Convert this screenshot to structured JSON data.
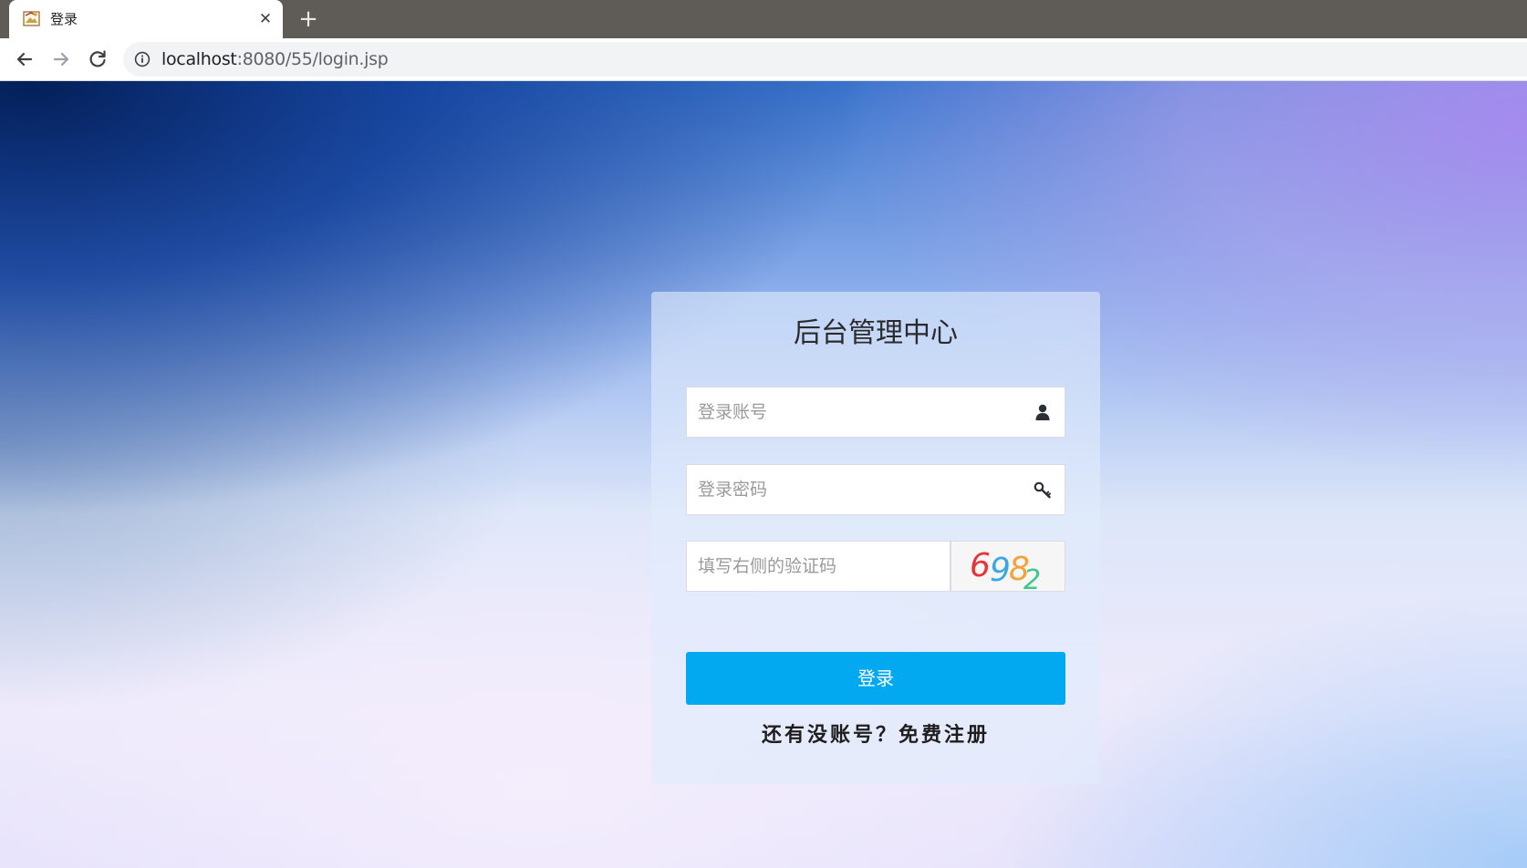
{
  "browser": {
    "tab": {
      "title": "登录",
      "close_glyph": "✕",
      "favicon_icon": "page-favicon-icon"
    },
    "new_tab_glyph": "+",
    "toolbar": {
      "back_icon": "arrow-left-icon",
      "forward_icon": "arrow-right-icon",
      "reload_icon": "reload-icon",
      "info_icon": "info-circle-icon"
    },
    "address": {
      "host": "localhost",
      "rest": ":8080/55/login.jsp"
    }
  },
  "login": {
    "title": "后台管理中心",
    "username_placeholder": "登录账号",
    "username_icon": "user-icon",
    "password_placeholder": "登录密码",
    "password_icon": "key-icon",
    "captcha_placeholder": "填写右侧的验证码",
    "captcha_text": "6982",
    "submit_label": "登录",
    "register_text": "还有没账号？免费注册"
  },
  "colors": {
    "tabstrip": "#5f5b57",
    "accent_button": "#02a9f1",
    "bg_dark_blue": "#0a2a6e",
    "bg_light_lavender": "#efe9fa"
  }
}
